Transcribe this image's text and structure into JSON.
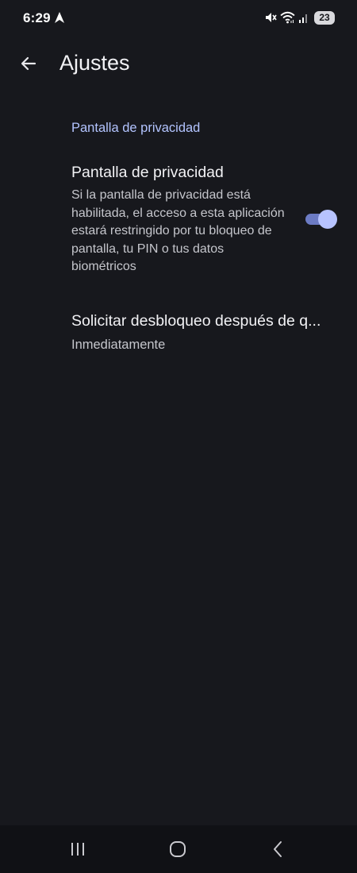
{
  "status_bar": {
    "time": "6:29",
    "battery": "23",
    "icons": [
      "navigation-arrow-icon",
      "mute-icon",
      "wifi-icon",
      "signal-icon",
      "battery-icon"
    ]
  },
  "app_bar": {
    "back_icon": "back-arrow-icon",
    "title": "Ajustes"
  },
  "section": {
    "header": "Pantalla de privacidad"
  },
  "privacy_setting": {
    "title": "Pantalla de privacidad",
    "description": "Si la pantalla de privacidad está habilitada, el acceso a esta aplicación estará restringido por tu bloqueo de pantalla, tu PIN o tus datos biométricos",
    "toggle_on": true
  },
  "unlock_setting": {
    "title": "Solicitar desbloqueo después de q...",
    "value": "Inmediatamente"
  },
  "nav_bar": {
    "icons": [
      "recents-icon",
      "home-icon",
      "back-icon"
    ]
  },
  "colors": {
    "background": "#17181d",
    "accent": "#b3c4ff",
    "toggle_track": "#6c7bc4",
    "toggle_thumb": "#b7c3ff",
    "nav_bar": "#101115"
  }
}
